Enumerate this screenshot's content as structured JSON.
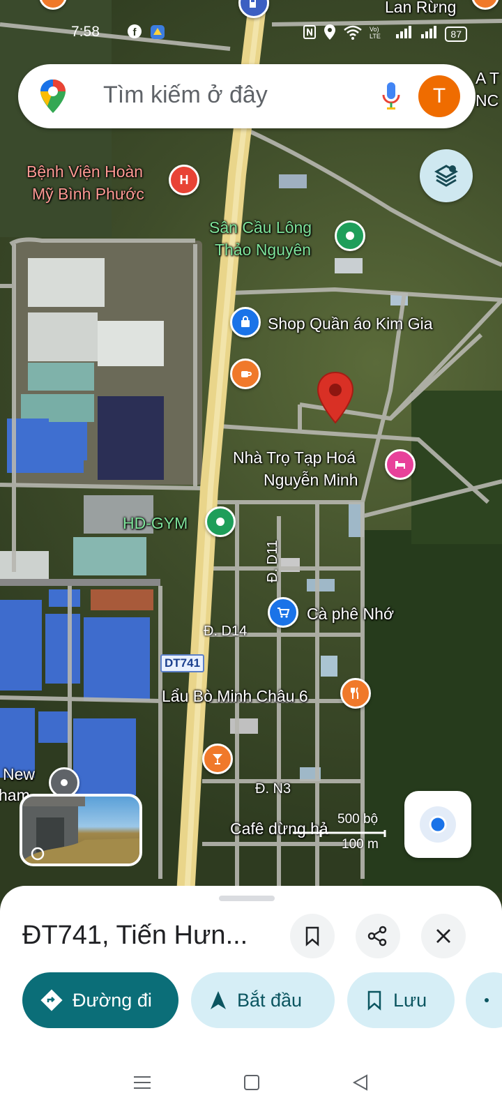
{
  "status_bar": {
    "time": "7:58",
    "battery": "87"
  },
  "search": {
    "placeholder": "Tìm kiếm ở đây",
    "avatar_letter": "T"
  },
  "map": {
    "top_label": "Lan Rừng",
    "right_edge_label": "A T\nNC",
    "pois": [
      {
        "name": "Bệnh Viện Hoàn Mỹ Bình Phước",
        "line1": "Bệnh Viện Hoàn",
        "line2": "Mỹ Bình Phước",
        "icon": "hospital-icon",
        "color": "#e84335"
      },
      {
        "name": "Sân Cầu Lông Thảo Nguyên",
        "line1": "Sân Cầu Lông",
        "line2": "Thảo Nguyên",
        "icon": "sports-icon",
        "color": "#1e9e5a"
      },
      {
        "name": "Shop Quần áo Kim Gia",
        "line1": "Shop Quần áo Kim Gia",
        "icon": "shopping-bag-icon",
        "color": "#1a73e8"
      },
      {
        "name": "Cafe",
        "icon": "coffee-cup-icon",
        "color": "#f0792a"
      },
      {
        "name": "Nhà Trọ Tạp Hoá Nguyễn Minh",
        "line1": "Nhà Trọ Tạp Hoá",
        "line2": "Nguyễn Minh",
        "icon": "bed-icon",
        "color": "#e8419a"
      },
      {
        "name": "HD-GYM",
        "line1": "HD-GYM",
        "icon": "sports-icon",
        "color": "#1e9e5a"
      },
      {
        "name": "Cà phê Nhớ",
        "line1": "Cà phê Nhớ",
        "icon": "cart-icon",
        "color": "#1a73e8"
      },
      {
        "name": "Lẩu Bò Minh Châu 6",
        "line1": "Lẩu Bò Minh Châu 6",
        "icon": "restaurant-icon",
        "color": "#f0792a"
      },
      {
        "name": "Bar",
        "icon": "cocktail-icon",
        "color": "#f0792a"
      },
      {
        "name": "New",
        "line1": "New",
        "line2": "ham",
        "icon": "place-icon",
        "color": "#5f6368"
      },
      {
        "name": "Cafê dừng hả",
        "line1": "Cafê dừng hả",
        "icon": "coffee-cup-icon",
        "color": "#f0792a"
      }
    ],
    "roads": {
      "d11": "Đ. D11",
      "d14": "Đ. D14",
      "n3": "Đ. N3",
      "shield": "DT741"
    },
    "scale": {
      "top": "500 bộ",
      "bottom": "100 m"
    }
  },
  "sheet": {
    "title": "ĐT741, Tiến Hưn...",
    "actions": {
      "directions": "Đường đi",
      "start": "Bắt đầu",
      "save": "Lưu"
    }
  },
  "colors": {
    "accent": "#0b6e78",
    "pin": "#d93025",
    "secondary_chip": "#d6eef6"
  }
}
